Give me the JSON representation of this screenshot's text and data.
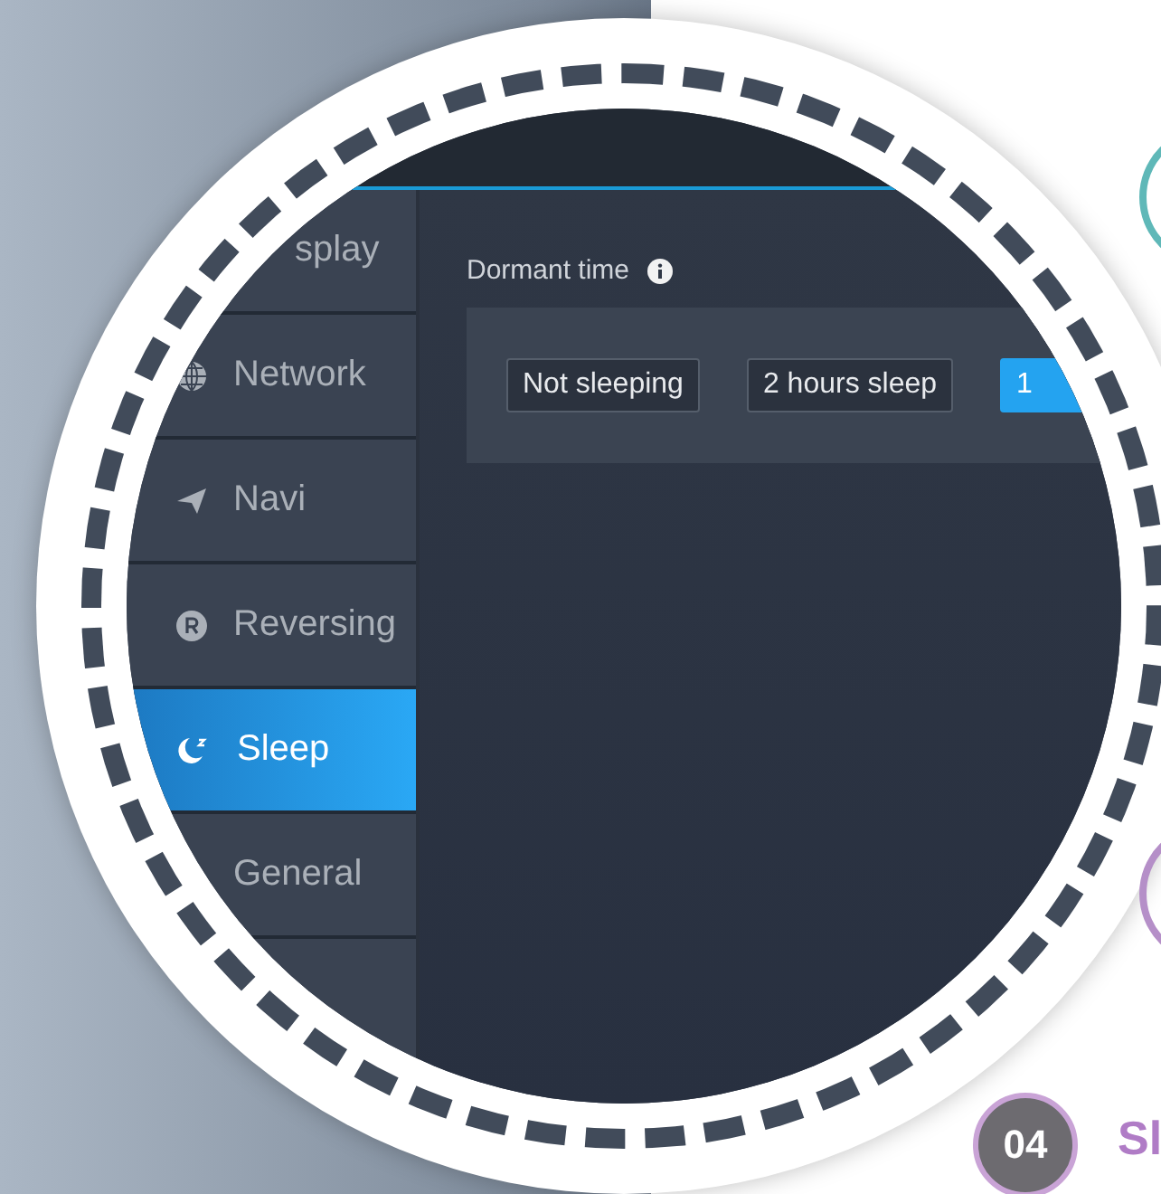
{
  "sidebar": {
    "items": [
      {
        "label": "splay",
        "kind": "clipped",
        "selected": false
      },
      {
        "label": "Network",
        "kind": "globe",
        "selected": false
      },
      {
        "label": "Navi",
        "kind": "plane",
        "selected": false
      },
      {
        "label": "Reversing",
        "kind": "r-circle",
        "selected": false
      },
      {
        "label": "Sleep",
        "kind": "moon",
        "selected": true
      },
      {
        "label": "General",
        "kind": "plain",
        "selected": false
      }
    ]
  },
  "content": {
    "section_label": "Dormant time",
    "options": [
      {
        "label": "Not sleeping",
        "selected": false
      },
      {
        "label": "2 hours sleep",
        "selected": false
      },
      {
        "label": "1",
        "selected": true
      }
    ]
  },
  "step": {
    "number": "04",
    "title": "Sl"
  }
}
